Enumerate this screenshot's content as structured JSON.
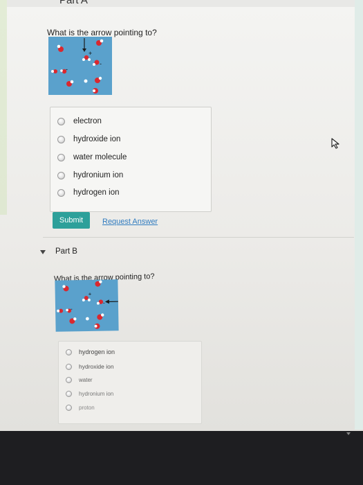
{
  "part_a": {
    "title": "Part A",
    "question": "What is the arrow pointing to?",
    "choices": [
      "electron",
      "hydroxide ion",
      "water molecule",
      "hydronium ion",
      "hydrogen ion"
    ],
    "submit_label": "Submit",
    "request_label": "Request Answer"
  },
  "part_b": {
    "title": "Part B",
    "question": "What is the arrow pointing to?",
    "choices": [
      "hydrogen ion",
      "hydroxide ion",
      "water",
      "hydronium ion",
      "proton"
    ]
  },
  "image_labels": {
    "plus": "+",
    "minus": "-"
  },
  "colors": {
    "accent": "#2da09a",
    "link": "#2f7bbf",
    "image_bg": "#5aa1cc",
    "oxygen": "#d9282f",
    "hydrogen": "#ffffff"
  }
}
